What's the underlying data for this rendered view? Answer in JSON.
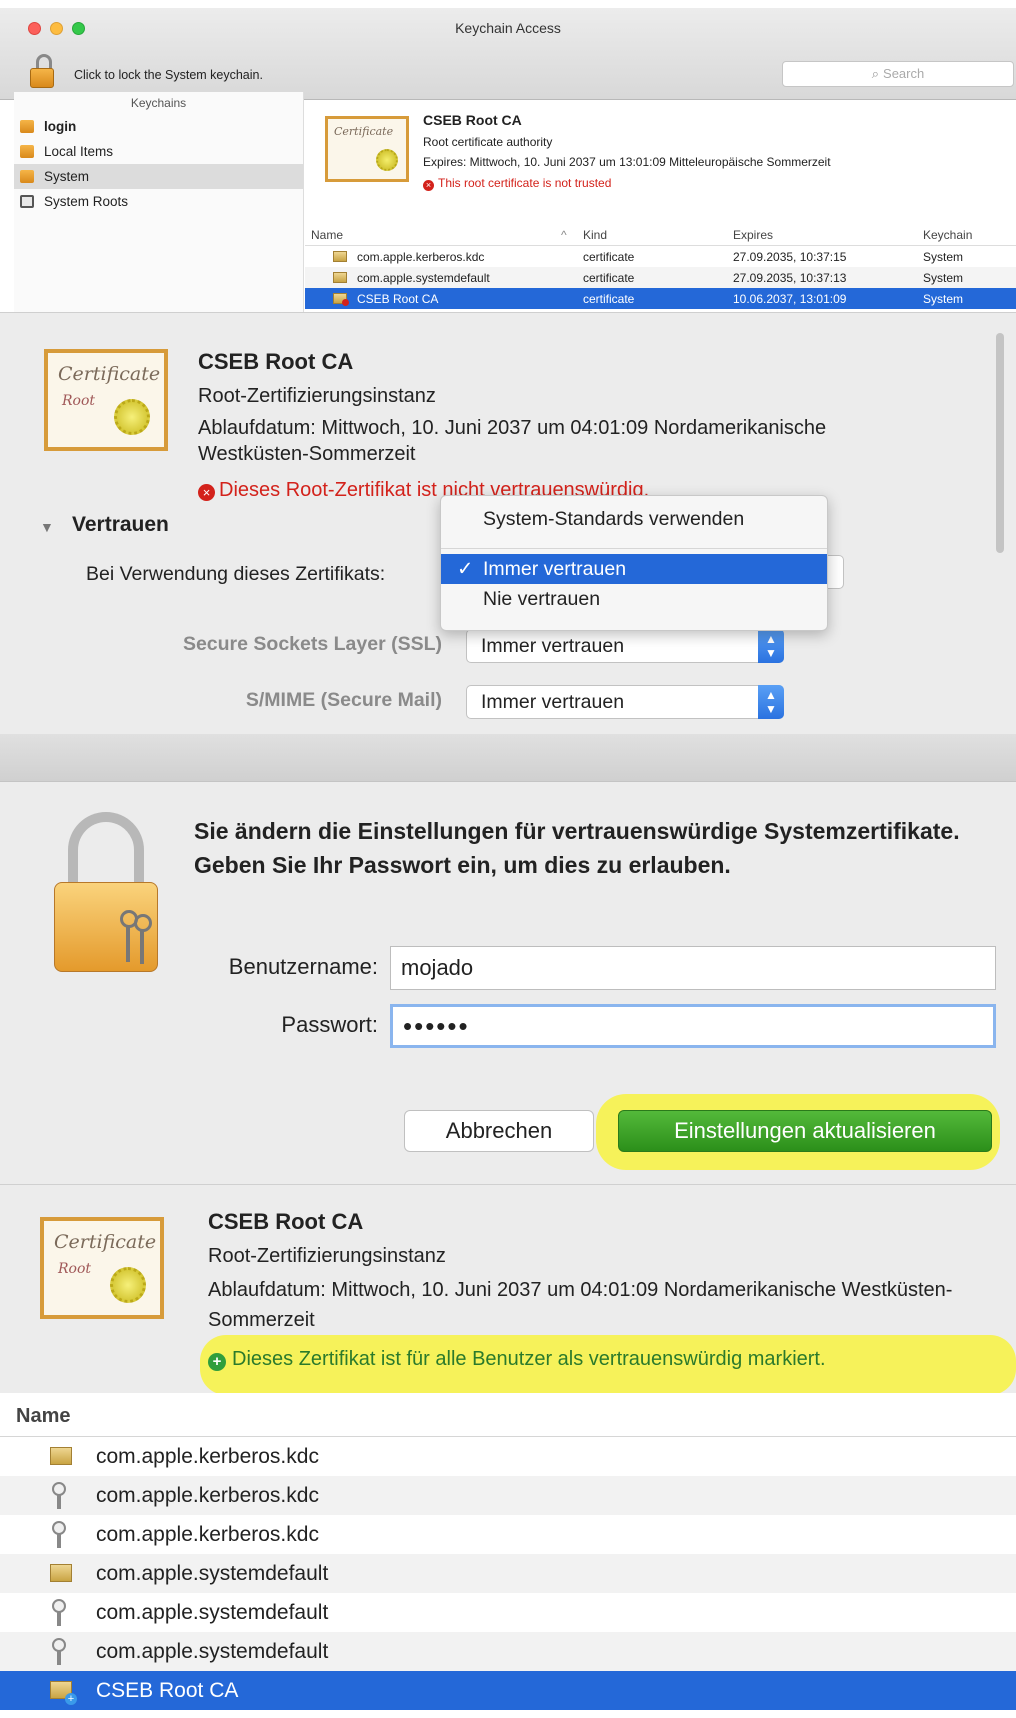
{
  "panel1": {
    "window_title": "Keychain Access",
    "lock_text": "Click to lock the System keychain.",
    "search_placeholder": "Search",
    "keychains_header": "Keychains",
    "keychains": [
      {
        "label": "login",
        "icon": "lock-open-icon"
      },
      {
        "label": "Local Items",
        "icon": "lock-open-icon"
      },
      {
        "label": "System",
        "icon": "lock-icon"
      },
      {
        "label": "System Roots",
        "icon": "folder-icon"
      }
    ],
    "detail": {
      "title": "CSEB Root CA",
      "subtitle": "Root certificate authority",
      "expires": "Expires: Mittwoch, 10. Juni 2037 um 13:01:09 Mitteleuropäische Sommerzeit",
      "warning": "This root certificate is not trusted"
    },
    "table": {
      "headers": {
        "name": "Name",
        "kind": "Kind",
        "expires": "Expires",
        "keychain": "Keychain"
      },
      "rows": [
        {
          "name": "com.apple.kerberos.kdc",
          "kind": "certificate",
          "expires": "27.09.2035, 10:37:15",
          "keychain": "System"
        },
        {
          "name": "com.apple.systemdefault",
          "kind": "certificate",
          "expires": "27.09.2035, 10:37:13",
          "keychain": "System"
        },
        {
          "name": "CSEB Root CA",
          "kind": "certificate",
          "expires": "10.06.2037, 13:01:09",
          "keychain": "System"
        }
      ]
    },
    "cert_script": "Certificate"
  },
  "panel2": {
    "title": "CSEB Root CA",
    "subtitle": "Root-Zertifizierungsinstanz",
    "expires": "Ablaufdatum: Mittwoch, 10. Juni 2037 um 04:01:09 Nordamerikanische Westküsten-Sommerzeit",
    "warning": "Dieses Root-Zertifikat ist nicht vertrauenswürdig.",
    "trust_heading": "Vertrauen",
    "when_using": "Bei Verwendung dieses Zertifikats:",
    "menu": {
      "item_defaults": "System-Standards verwenden",
      "item_always": "Immer vertrauen",
      "item_never": "Nie vertrauen",
      "check": "✓"
    },
    "ssl_label": "Secure Sockets Layer (SSL)",
    "ssl_value": "Immer vertrauen",
    "smime_label": "S/MIME (Secure Mail)",
    "smime_value": "Immer vertrauen",
    "cert_script": "Certificate",
    "cert_script2": "Root"
  },
  "panel3": {
    "message": "Sie ändern die Einstellungen für vertrauenswürdige Systemzertifikate. Geben Sie Ihr Passwort ein, um dies zu erlauben.",
    "username_label": "Benutzername:",
    "username_value": "mojado",
    "password_label": "Passwort:",
    "password_value": "••••••",
    "cancel_label": "Abbrechen",
    "ok_label": "Einstellungen aktualisieren"
  },
  "panel4": {
    "title": "CSEB Root CA",
    "subtitle": "Root-Zertifizierungsinstanz",
    "expires": "Ablaufdatum: Mittwoch, 10. Juni 2037 um 04:01:09 Nordamerikanische Westküsten-Sommerzeit",
    "trusted": "Dieses Zertifikat ist für alle Benutzer als vertrauenswürdig markiert.",
    "name_header": "Name",
    "rows": [
      {
        "label": "com.apple.kerberos.kdc",
        "icon": "certificate-icon"
      },
      {
        "label": "com.apple.kerberos.kdc",
        "icon": "key-icon"
      },
      {
        "label": "com.apple.kerberos.kdc",
        "icon": "key-icon"
      },
      {
        "label": "com.apple.systemdefault",
        "icon": "certificate-icon"
      },
      {
        "label": "com.apple.systemdefault",
        "icon": "key-icon"
      },
      {
        "label": "com.apple.systemdefault",
        "icon": "key-icon"
      },
      {
        "label": "CSEB Root CA",
        "icon": "certificate-plus-icon"
      }
    ],
    "cert_script": "Certificate",
    "cert_script2": "Root"
  },
  "colors": {
    "selection": "#2468d8",
    "error": "#d3221b",
    "success": "#2f9e3c",
    "highlight": "#f6f25a",
    "cert_border": "#d79b3a"
  }
}
